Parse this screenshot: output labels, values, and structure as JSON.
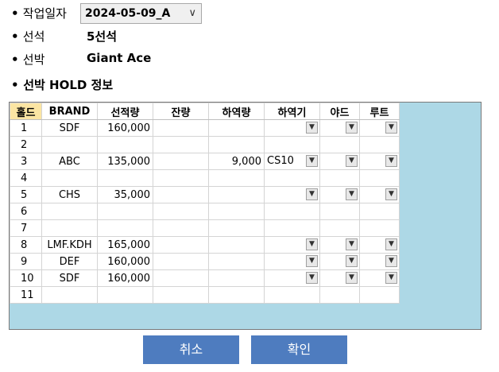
{
  "form": {
    "work_date_label": "작업일자",
    "work_date_value": "2024-05-09_A",
    "berth_label": "선석",
    "berth_value": "5선석",
    "vessel_label": "선박",
    "vessel_value": "Giant Ace",
    "hold_info_label": "선박 HOLD 정보"
  },
  "grid": {
    "columns": [
      "홀드",
      "BRAND",
      "선적량",
      "잔량",
      "하역량",
      "하역기",
      "야드",
      "루트"
    ],
    "rows": [
      {
        "hold": "1",
        "brand": "SDF",
        "loaded": "160,000",
        "remaining": "",
        "unloaded": "",
        "crane": "",
        "combos": true
      },
      {
        "hold": "2",
        "brand": "",
        "loaded": "",
        "remaining": "",
        "unloaded": "",
        "crane": "",
        "combos": false
      },
      {
        "hold": "3",
        "brand": "ABC",
        "loaded": "135,000",
        "remaining": "",
        "unloaded": "9,000",
        "crane": "CS10",
        "combos": true
      },
      {
        "hold": "4",
        "brand": "",
        "loaded": "",
        "remaining": "",
        "unloaded": "",
        "crane": "",
        "combos": false
      },
      {
        "hold": "5",
        "brand": "CHS",
        "loaded": "35,000",
        "remaining": "",
        "unloaded": "",
        "crane": "",
        "combos": true
      },
      {
        "hold": "6",
        "brand": "",
        "loaded": "",
        "remaining": "",
        "unloaded": "",
        "crane": "",
        "combos": false
      },
      {
        "hold": "7",
        "brand": "",
        "loaded": "",
        "remaining": "",
        "unloaded": "",
        "crane": "",
        "combos": false
      },
      {
        "hold": "8",
        "brand": "LMF.KDH",
        "loaded": "165,000",
        "remaining": "",
        "unloaded": "",
        "crane": "",
        "combos": true
      },
      {
        "hold": "9",
        "brand": "DEF",
        "loaded": "160,000",
        "remaining": "",
        "unloaded": "",
        "crane": "",
        "combos": true
      },
      {
        "hold": "10",
        "brand": "SDF",
        "loaded": "160,000",
        "remaining": "",
        "unloaded": "",
        "crane": "",
        "combos": true
      },
      {
        "hold": "11",
        "brand": "",
        "loaded": "",
        "remaining": "",
        "unloaded": "",
        "crane": "",
        "combos": false
      }
    ]
  },
  "buttons": {
    "cancel_label": "취소",
    "confirm_label": "확인"
  },
  "colors": {
    "button_bg": "#4e7cbf",
    "grid_empty_area": "#add8e6",
    "hold_header": "#fbe5a3"
  },
  "icons": {
    "bullet": "•",
    "dropdown_arrow": "∨",
    "grid_combo_arrow": "▼"
  }
}
